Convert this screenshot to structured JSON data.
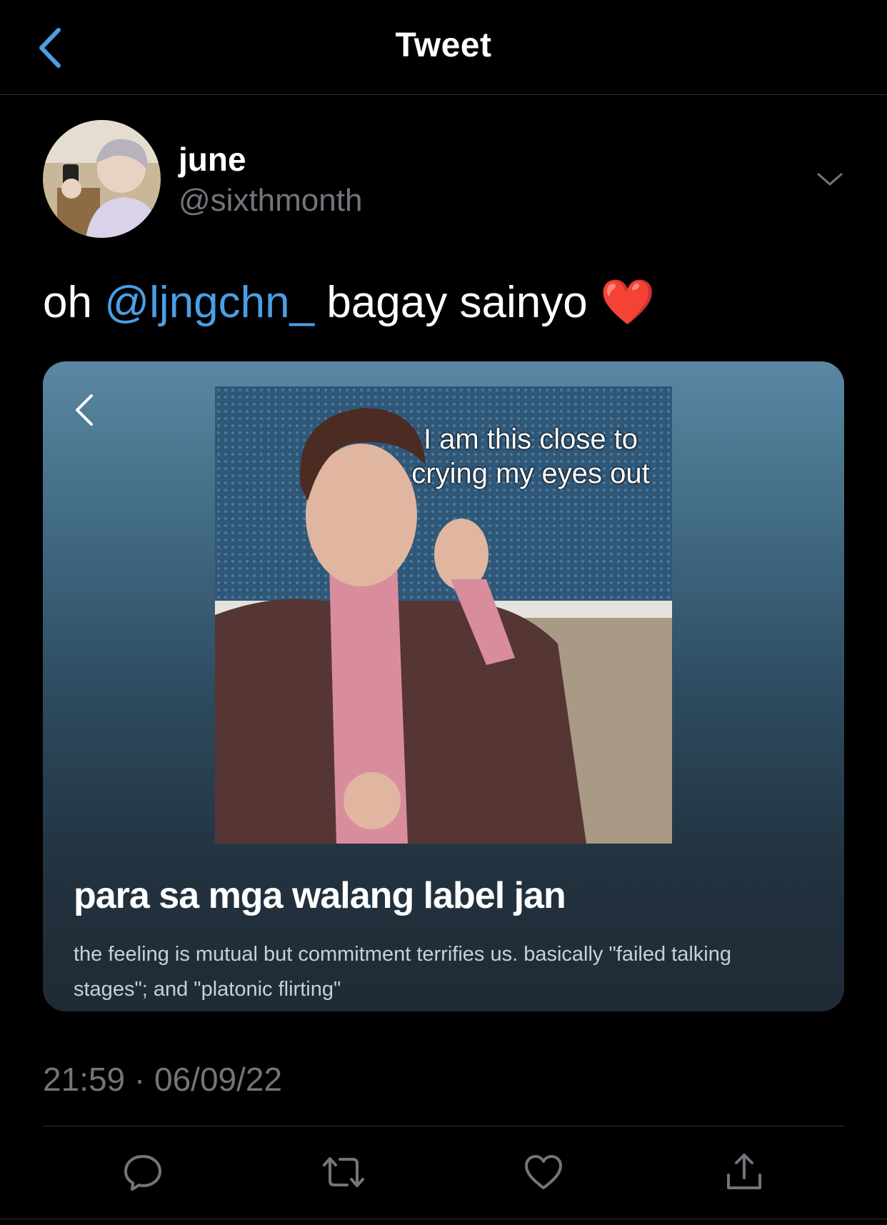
{
  "header": {
    "title": "Tweet",
    "back_icon": "chevron-left-icon"
  },
  "author": {
    "name": "june",
    "handle": "@sixthmonth",
    "more_icon": "chevron-down-icon"
  },
  "tweet": {
    "prefix": "oh ",
    "mention": "@ljngchn_",
    "suffix": " bagay sainyo ",
    "emoji": "❤️"
  },
  "card": {
    "back_icon": "chevron-left-icon",
    "image_caption": "I am this close to crying my eyes out",
    "title": "para sa mga walang label jan",
    "description": "the feeling is mutual but commitment terrifies us. basically \"failed talking stages\"; and \"platonic flirting\""
  },
  "timestamp": "21:59 · 06/09/22",
  "actions": {
    "reply": "speech-bubble-icon",
    "retweet": "retweet-icon",
    "like": "heart-icon",
    "share": "share-icon"
  },
  "colors": {
    "background": "#000000",
    "accent": "#4a9fe5",
    "muted": "#71767b",
    "divider": "#2f3336"
  }
}
